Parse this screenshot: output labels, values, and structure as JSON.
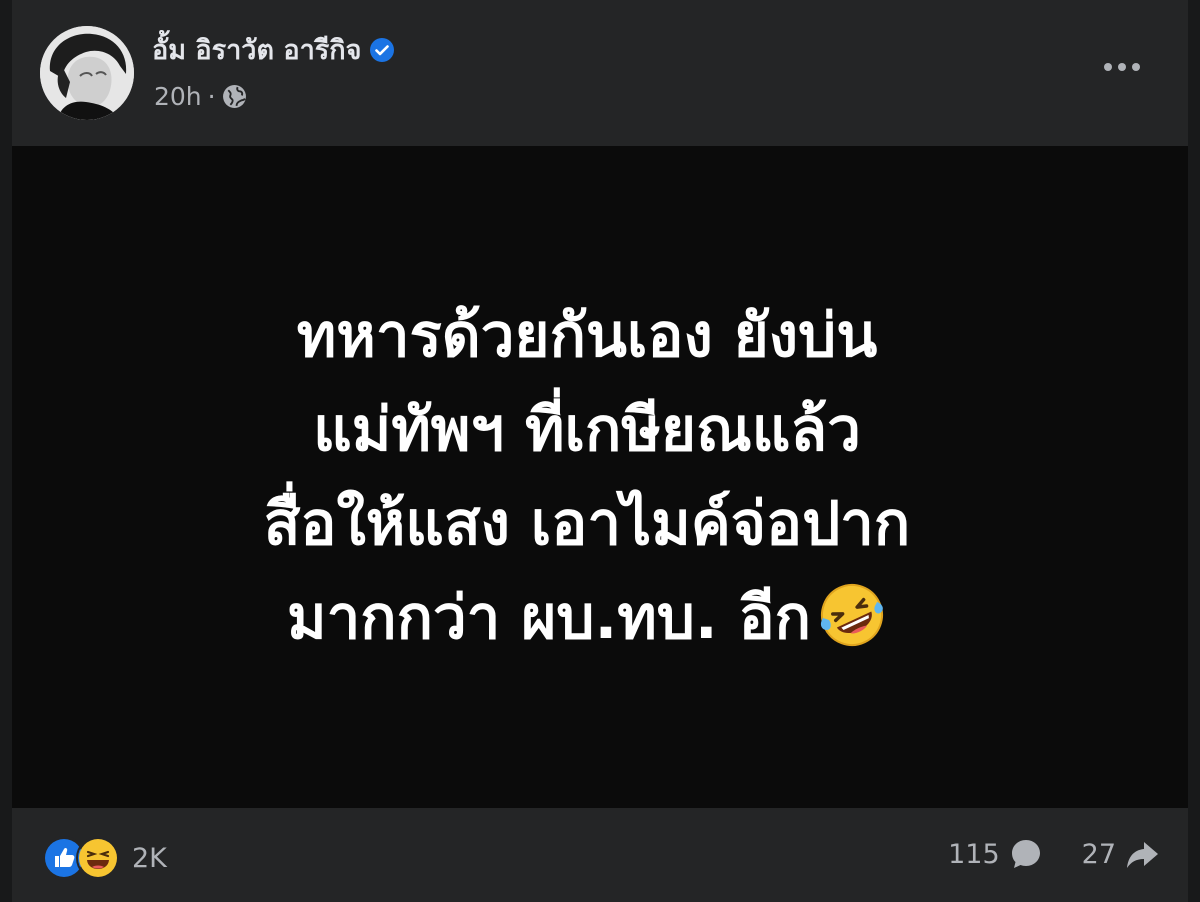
{
  "author": {
    "name": "อั้ม อิราวัต อารีกิจ",
    "verified_icon": "verified-badge-icon",
    "time": "20h",
    "separator": "·",
    "audience_icon": "globe-icon"
  },
  "post": {
    "lines": [
      "ทหารด้วยกันเอง ยังบ่น",
      "แม่ทัพฯ ที่เกษียณแล้ว",
      "สื่อให้แสง เอาไมค์จ่อปาก",
      "มากกว่า ผบ.ทบ. อีก"
    ],
    "trailing_emoji": "rolling-on-floor-laughing-emoji",
    "background": "#0b0b0b",
    "text_color": "#ffffff"
  },
  "footer": {
    "reaction_icons": [
      "like-icon",
      "haha-icon"
    ],
    "reaction_count": "2K",
    "comment_count": "115",
    "share_count": "27"
  },
  "colors": {
    "card": "#242526",
    "accent": "#1b74e4",
    "muted_text": "#b0b3b8"
  }
}
